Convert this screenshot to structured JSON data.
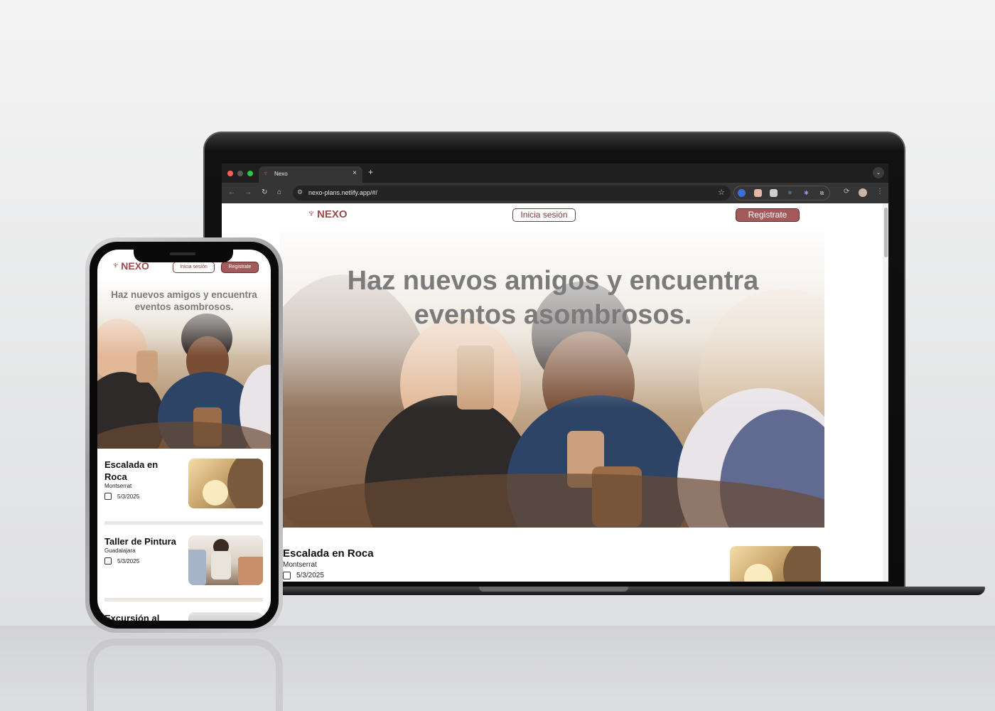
{
  "browser": {
    "tab_title": "Nexo",
    "url": "nexo-plans.netlify.app/#/",
    "new_tab_symbol": "+",
    "close_symbol": "×"
  },
  "site": {
    "logo_text": "NEXO",
    "login_label": "Inicia sesión",
    "signup_label": "Registrate",
    "hero_title": "Haz nuevos amigos y encuentra eventos asombrosos.",
    "brand_color": "#a45a5a",
    "accent_dark": "#7d3c3c"
  },
  "events": [
    {
      "title": "Escalada en Roca",
      "location": "Montserrat",
      "date": "5/3/2025",
      "icon": "calendar-icon"
    },
    {
      "title": "Taller de Pintura",
      "location": "Guadalajara",
      "date": "5/3/2025",
      "icon": "calendar-icon"
    },
    {
      "title": "Excursión al",
      "location": "",
      "date": "",
      "icon": "calendar-icon"
    }
  ]
}
